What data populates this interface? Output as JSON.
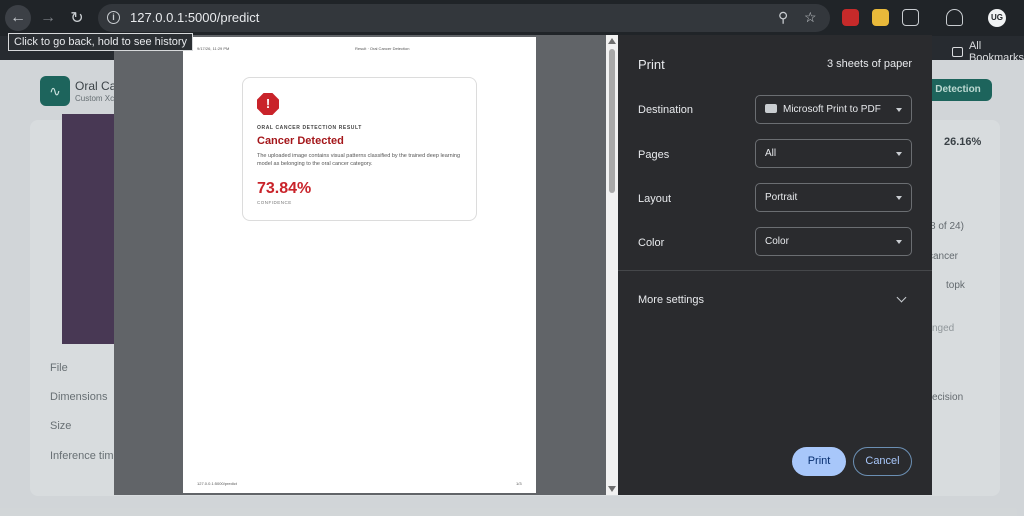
{
  "browser": {
    "url": "127.0.0.1:5000/predict",
    "tooltip": "Click to go back, hold to see history",
    "bookmarks_label": "All Bookmarks"
  },
  "background_page": {
    "app_title": "Oral Ca",
    "app_subtitle": "Custom Xc",
    "detect_button": "Detection",
    "percent": "26.16%",
    "right_fragments": [
      "8 of 24)",
      "cancer",
      "topk",
      "nged",
      "ecision"
    ],
    "labels": [
      "File",
      "Dimensions",
      "Size",
      "Inference tim"
    ]
  },
  "preview": {
    "header_left": "9/17/26, 11:29 PM",
    "header_center": "Result · Oral Cancer Detection",
    "kicker": "ORAL CANCER DETECTION RESULT",
    "title": "Cancer Detected",
    "description": "The uploaded image contains visual patterns classified by the trained deep learning model as belonging to the oral cancer category.",
    "confidence": "73.84%",
    "confidence_label": "CONFIDENCE",
    "footer_left": "127.0.0.1:5000/predict",
    "footer_right": "1/3"
  },
  "print": {
    "title": "Print",
    "sheets": "3 sheets of paper",
    "destination_label": "Destination",
    "destination_value": "Microsoft Print to PDF",
    "pages_label": "Pages",
    "pages_value": "All",
    "layout_label": "Layout",
    "layout_value": "Portrait",
    "color_label": "Color",
    "color_value": "Color",
    "more_settings": "More settings",
    "print_button": "Print",
    "cancel_button": "Cancel"
  }
}
